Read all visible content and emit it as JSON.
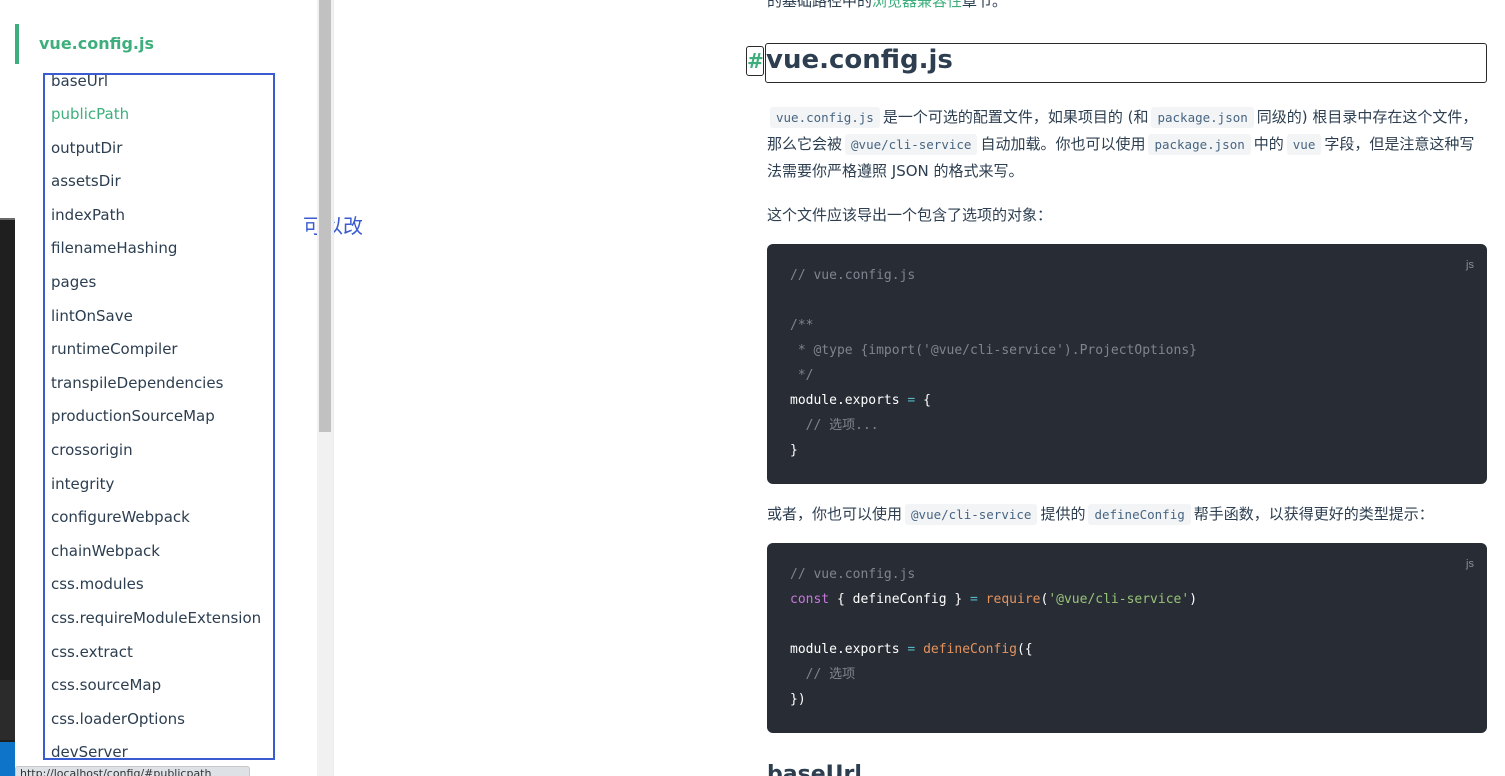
{
  "top_fragment": {
    "prefix": "的基础路径中的",
    "link": "浏览器兼容性",
    "suffix": "章节。"
  },
  "sidebar": {
    "group_title": "vue.config.js",
    "items": [
      {
        "label": "baseUrl",
        "active": false
      },
      {
        "label": "publicPath",
        "active": true
      },
      {
        "label": "outputDir",
        "active": false
      },
      {
        "label": "assetsDir",
        "active": false
      },
      {
        "label": "indexPath",
        "active": false
      },
      {
        "label": "filenameHashing",
        "active": false
      },
      {
        "label": "pages",
        "active": false
      },
      {
        "label": "lintOnSave",
        "active": false
      },
      {
        "label": "runtimeCompiler",
        "active": false
      },
      {
        "label": "transpileDependencies",
        "active": false
      },
      {
        "label": "productionSourceMap",
        "active": false
      },
      {
        "label": "crossorigin",
        "active": false
      },
      {
        "label": "integrity",
        "active": false
      },
      {
        "label": "configureWebpack",
        "active": false
      },
      {
        "label": "chainWebpack",
        "active": false
      },
      {
        "label": "css.modules",
        "active": false
      },
      {
        "label": "css.requireModuleExtension",
        "active": false
      },
      {
        "label": "css.extract",
        "active": false
      },
      {
        "label": "css.sourceMap",
        "active": false
      },
      {
        "label": "css.loaderOptions",
        "active": false
      },
      {
        "label": "devServer",
        "active": false
      }
    ]
  },
  "annotation": {
    "text": "可以改",
    "color": "#3b5bd0"
  },
  "status_url": "http://localhost/config/#publicpath",
  "content": {
    "hash": "#",
    "heading": "vue.config.js",
    "para1": {
      "c1": "vue.config.js",
      "t1": "是一个可选的配置文件，如果项目的 (和",
      "c2": "package.json",
      "t2": "同级的) 根目录中存在这个文件，那么它会被",
      "c3": "@vue/cli-service",
      "t3": "自动加载。你也可以使用",
      "c4": "package.json",
      "t4": "中的",
      "c5": "vue",
      "t5": "字段，但是注意这种写法需要你严格遵照 JSON 的格式来写。"
    },
    "para2": "这个文件应该导出一个包含了选项的对象：",
    "code1": {
      "lang": "js",
      "l1": "// vue.config.js",
      "l3": "/**",
      "l4": " * @type {import('@vue/cli-service').ProjectOptions}",
      "l5": " */",
      "l6a": "module.exports",
      "l6b": " = ",
      "l6c": "{",
      "l7": "  // 选项...",
      "l8": "}"
    },
    "para3": {
      "t1": "或者，你也可以使用",
      "c1": "@vue/cli-service",
      "t2": "提供的",
      "c2": "defineConfig",
      "t3": "帮手函数，以获得更好的类型提示："
    },
    "code2": {
      "lang": "js",
      "l1": "// vue.config.js",
      "l2a": "const",
      "l2b": " { defineConfig } ",
      "l2c": "=",
      "l2d": " require",
      "l2e": "(",
      "l2f": "'@vue/cli-service'",
      "l2g": ")",
      "l4a": "module.exports",
      "l4b": " = ",
      "l4c": "defineConfig",
      "l4d": "({",
      "l5": "  // 选项",
      "l6": "})"
    },
    "next_heading": "baseUrl"
  },
  "colors": {
    "accent": "#3eaf7c",
    "code_bg": "#282c34",
    "annotation": "#3b5bd0"
  }
}
